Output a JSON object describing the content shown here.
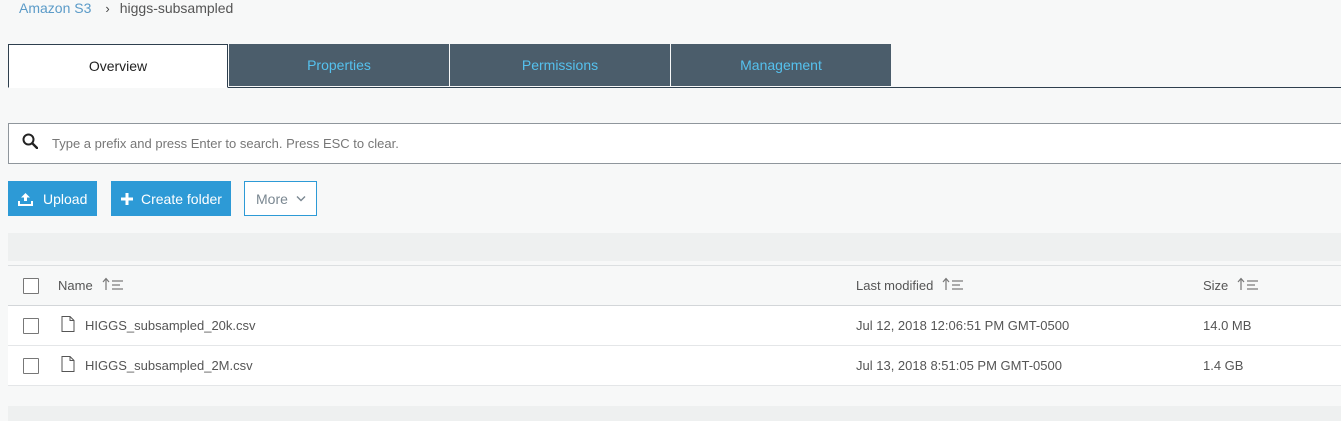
{
  "breadcrumb": {
    "root": "Amazon S3",
    "separator": "›",
    "current": "higgs-subsampled"
  },
  "tabs": [
    {
      "label": "Overview",
      "active": true
    },
    {
      "label": "Properties",
      "active": false
    },
    {
      "label": "Permissions",
      "active": false
    },
    {
      "label": "Management",
      "active": false
    }
  ],
  "search": {
    "placeholder": "Type a prefix and press Enter to search. Press ESC to clear.",
    "value": ""
  },
  "actions": {
    "upload_label": "Upload",
    "create_folder_label": "Create folder",
    "more_label": "More"
  },
  "table": {
    "columns": {
      "name": "Name",
      "last_modified": "Last modified",
      "size": "Size"
    },
    "rows": [
      {
        "name": "HIGGS_subsampled_20k.csv",
        "last_modified": "Jul 12, 2018 12:06:51 PM GMT-0500",
        "size": "14.0 MB"
      },
      {
        "name": "HIGGS_subsampled_2M.csv",
        "last_modified": "Jul 13, 2018 8:51:05 PM GMT-0500",
        "size": "1.4 GB"
      }
    ]
  },
  "colors": {
    "accent": "#2d9ad6",
    "tab_bg": "#4b5d6b",
    "tab_text": "#55c1ee",
    "link": "#5b9bc8"
  }
}
